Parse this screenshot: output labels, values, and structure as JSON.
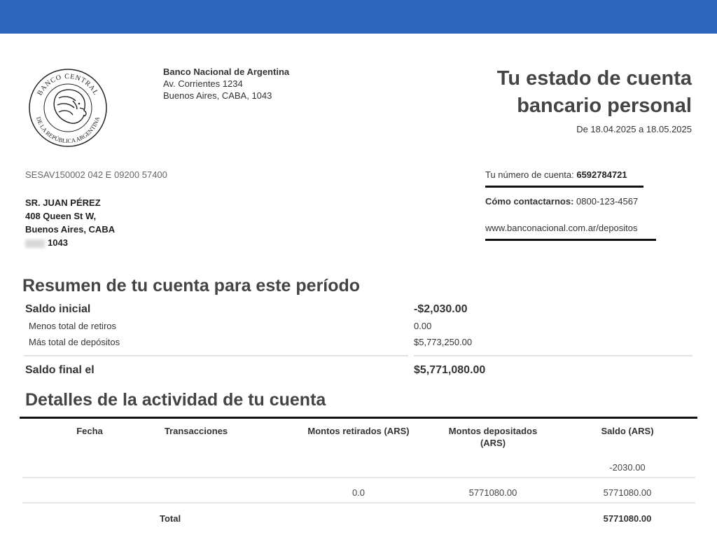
{
  "bank": {
    "name": "Banco Nacional de Argentina",
    "address1": "Av. Corrientes 1234",
    "address2": "Buenos Aires, CABA, 1043",
    "logo_text_top": "BANCO CENTRAL",
    "logo_text_bottom": "DE LA REPÚBLICA ARGENTINA"
  },
  "statement": {
    "title_line1": "Tu estado de cuenta",
    "title_line2": "bancario personal",
    "period": "De 18.04.2025 a 18.05.2025"
  },
  "reference_code": "SESAV150002 042 E 09200 57400",
  "customer": {
    "name": "SR. JUAN PÉREZ",
    "street": "408 Queen St W,",
    "city": "Buenos Aires, CABA",
    "postal": "1043"
  },
  "contact": {
    "account_label": "Tu número de cuenta:",
    "account_number": "6592784721",
    "contact_label": "Cómo contactarnos:",
    "phone": "0800-123-4567",
    "website": "www.banconacional.com.ar/depositos"
  },
  "summary": {
    "title": "Resumen de tu cuenta para este período",
    "opening_label": "Saldo inicial",
    "opening_value": "-$2,030.00",
    "withdrawals_label": "Menos total de retiros",
    "withdrawals_value": "0.00",
    "deposits_label": "Más total de depósitos",
    "deposits_value": "$5,773,250.00",
    "closing_label": "Saldo final el",
    "closing_value": "$5,771,080.00"
  },
  "activity": {
    "title": "Detalles de la actividad de tu cuenta",
    "columns": {
      "date": "Fecha",
      "transactions": "Transacciones",
      "withdrawn": "Montos retirados (ARS)",
      "deposited_line1": "Montos depositados",
      "deposited_line2": "(ARS)",
      "balance": "Saldo (ARS)"
    },
    "rows": [
      {
        "date": "",
        "transaction": "",
        "withdrawn": "",
        "deposited": "",
        "balance": "-2030.00"
      },
      {
        "date": "",
        "transaction": "",
        "withdrawn": "0.0",
        "deposited": "5771080.00",
        "balance": "5771080.00"
      }
    ],
    "total_label": "Total",
    "total_balance": "5771080.00"
  },
  "colors": {
    "topbar": "#2f66bd",
    "rule": "#111111"
  }
}
